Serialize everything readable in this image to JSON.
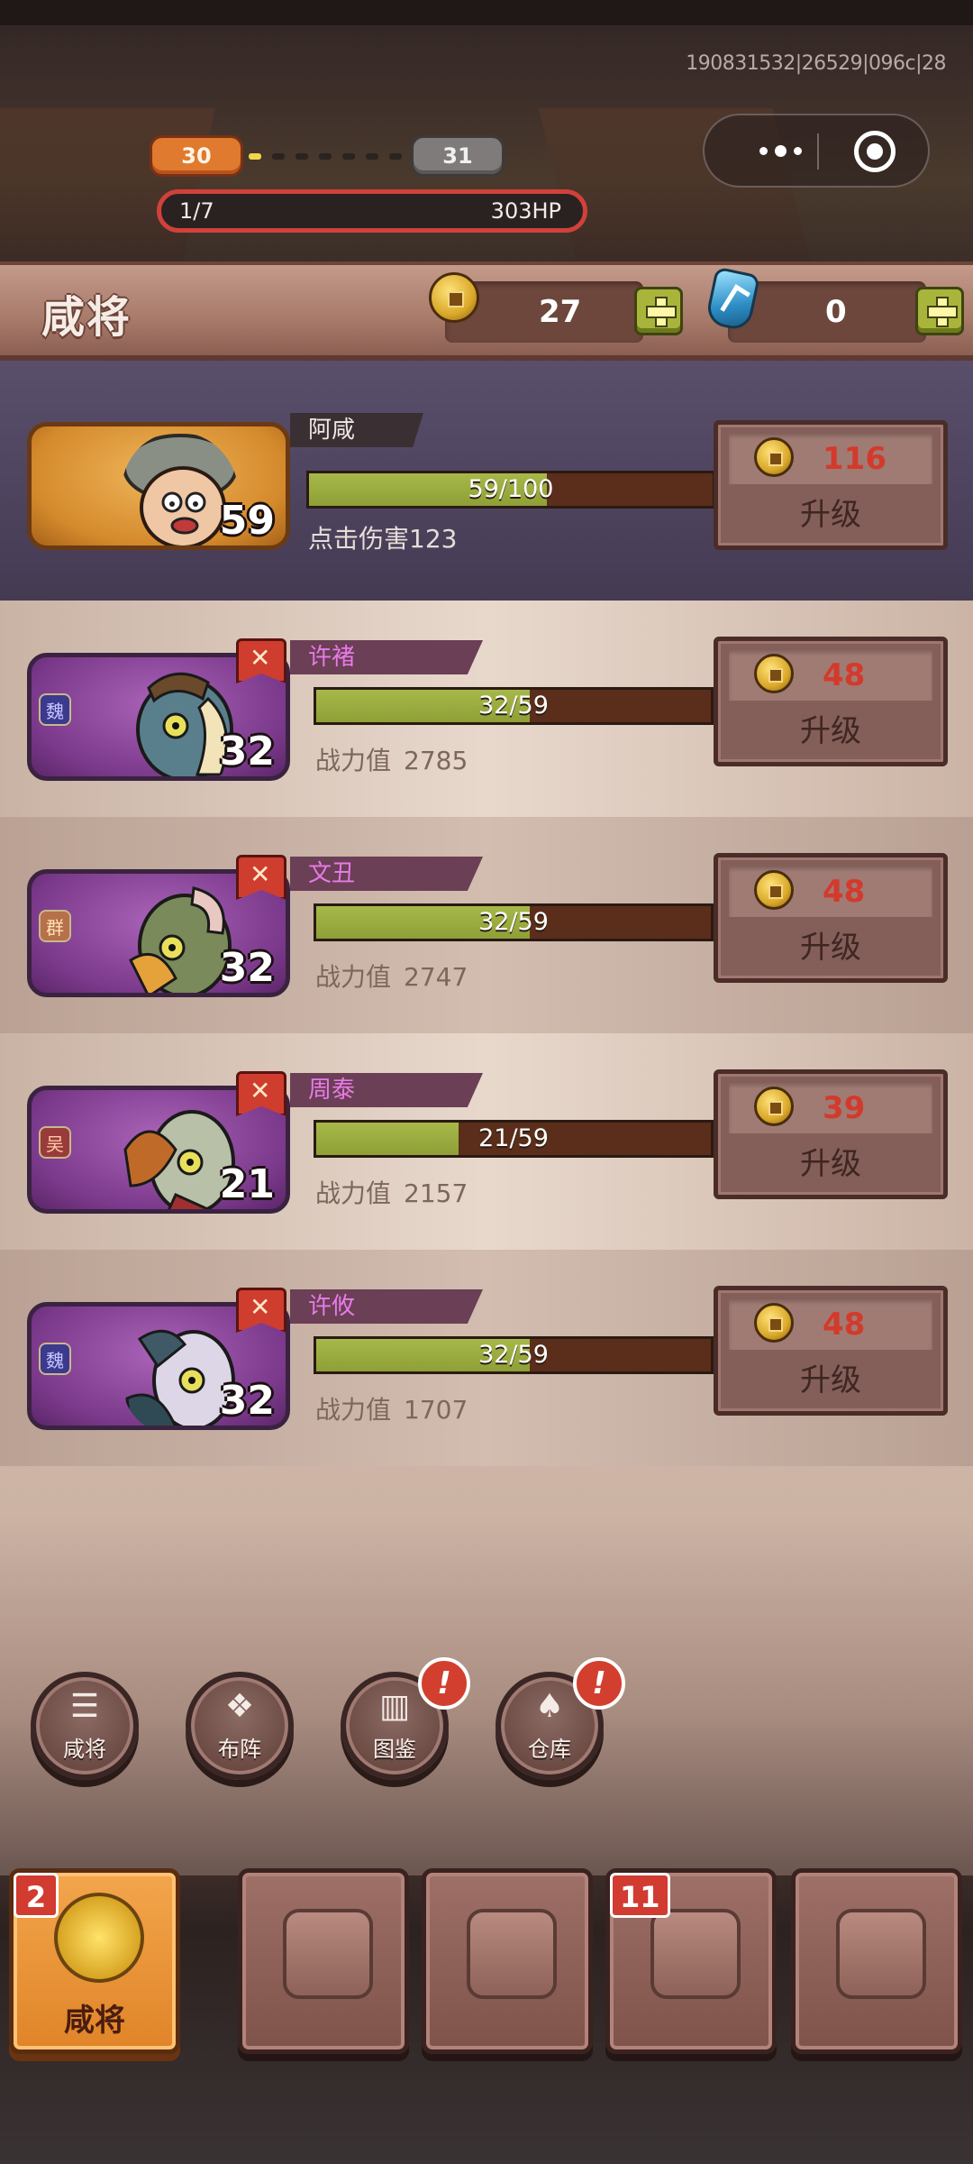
{
  "top": {
    "version": "190831532|26529|096c|28",
    "level_current": "30",
    "level_next": "31",
    "stage_progress": "1/7",
    "enemy_hp": "303HP",
    "capsule_more_icon": "more-dots-icon",
    "capsule_close_icon": "target-close-icon"
  },
  "header": {
    "title": "咸将",
    "gold": "27",
    "gems": "0"
  },
  "hero": {
    "name": "阿咸",
    "level": "59",
    "xp_text": "59/100",
    "xp_fraction": 0.59,
    "stat_label": "点击伤害123",
    "cost": "116",
    "upgrade_label": "升级"
  },
  "generals": [
    {
      "name": "许褚",
      "faction": "魏",
      "level": "32",
      "xp_text": "32/59",
      "xp_fraction": 0.54,
      "stat_label": "战力值",
      "stat_value": "2785",
      "cost": "48",
      "upgrade_label": "升级"
    },
    {
      "name": "文丑",
      "faction": "群",
      "level": "32",
      "xp_text": "32/59",
      "xp_fraction": 0.54,
      "stat_label": "战力值",
      "stat_value": "2747",
      "cost": "48",
      "upgrade_label": "升级"
    },
    {
      "name": "周泰",
      "faction": "吴",
      "level": "21",
      "xp_text": "21/59",
      "xp_fraction": 0.36,
      "stat_label": "战力值",
      "stat_value": "2157",
      "cost": "39",
      "upgrade_label": "升级"
    },
    {
      "name": "许攸",
      "faction": "魏",
      "level": "32",
      "xp_text": "32/59",
      "xp_fraction": 0.54,
      "stat_label": "战力值",
      "stat_value": "1707",
      "cost": "48",
      "upgrade_label": "升级"
    }
  ],
  "round_buttons": [
    {
      "label": "咸将",
      "icon": "grid-list-icon",
      "alert": false
    },
    {
      "label": "布阵",
      "icon": "formation-icon",
      "alert": false
    },
    {
      "label": "图鉴",
      "icon": "book-icon",
      "alert": true
    },
    {
      "label": "仓库",
      "icon": "bag-icon",
      "alert": true
    }
  ],
  "tabs": [
    {
      "label": "咸将",
      "icon": "helmet-icon",
      "badge": "2",
      "active": true
    },
    {
      "label": "",
      "icon": "armor-icon",
      "badge": "",
      "active": false
    },
    {
      "label": "",
      "icon": "shield-icon",
      "badge": "",
      "active": false
    },
    {
      "label": "",
      "icon": "treasure-chest-icon",
      "badge": "11",
      "active": false
    },
    {
      "label": "",
      "icon": "map-scroll-icon",
      "badge": "",
      "active": false
    }
  ],
  "colors": {
    "cost_red": "#d33a2c",
    "name_purple": "#e87ae8",
    "xp_green": "#a7b84a",
    "hp_border": "#d0413a",
    "tab_active": "#f3a64c"
  }
}
